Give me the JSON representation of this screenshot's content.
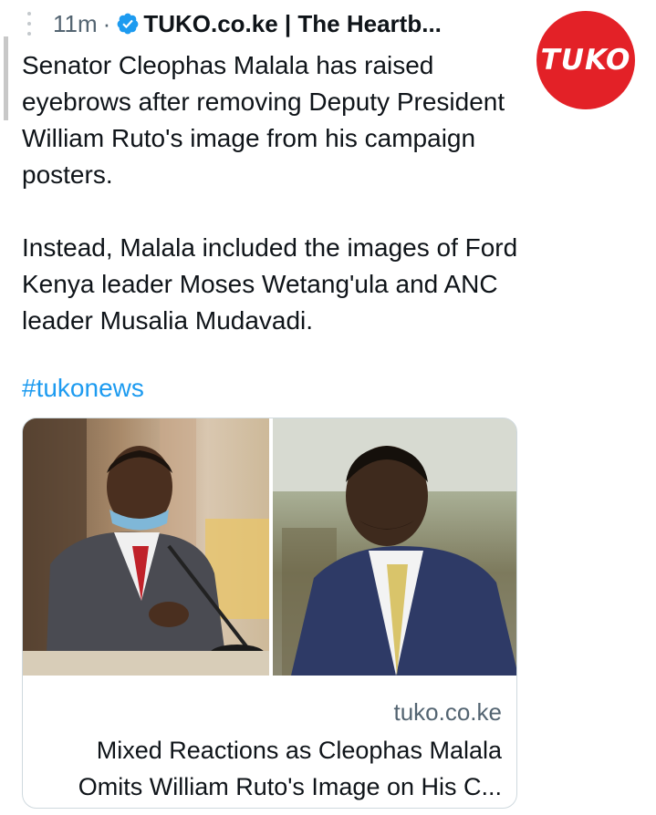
{
  "header": {
    "time": "11m",
    "separator": "·",
    "author": "TUKO.co.ke | The Heartb..."
  },
  "avatar": {
    "logo_text": "TUKO",
    "color": "#e32127"
  },
  "tweet": {
    "paragraph1": "Senator Cleophas Malala has raised eyebrows after removing Deputy President William Ruto's image from his campaign posters.",
    "paragraph2": "Instead, Malala included the images of Ford Kenya leader Moses Wetang'ula and ANC leader Musalia Mudavadi.",
    "hashtag": "#tukonews"
  },
  "card": {
    "domain": "tuko.co.ke",
    "title_line1": "Mixed Reactions as Cleophas Malala",
    "title_line2": "Omits William Ruto's Image on His C..."
  },
  "colors": {
    "link": "#1d9bf0",
    "text": "#0f1419",
    "muted": "#536471",
    "verified": "#1d9bf0",
    "brand": "#e32127"
  }
}
